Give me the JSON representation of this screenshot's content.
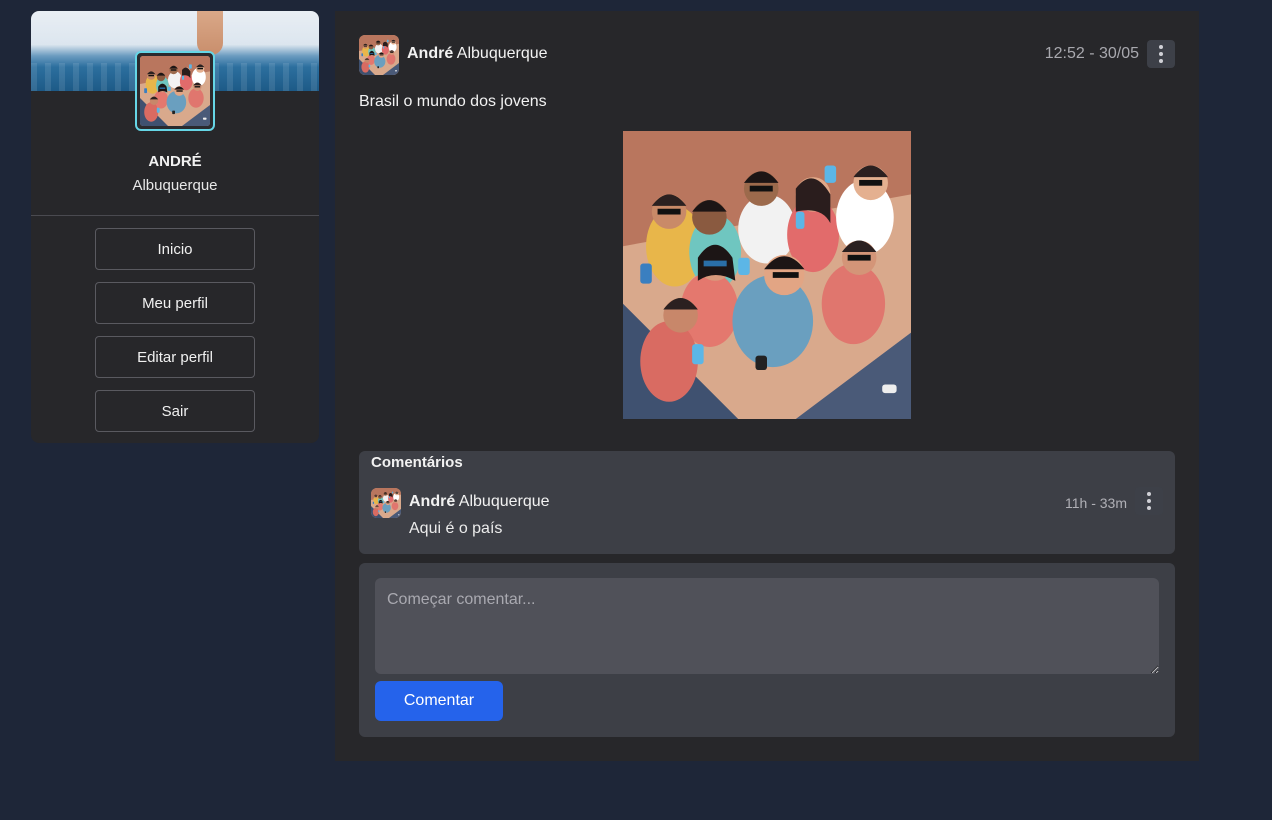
{
  "profile": {
    "first_name": "ANDRÉ",
    "last_name": "Albuquerque"
  },
  "sidebar": {
    "items": [
      {
        "label": "Inicio"
      },
      {
        "label": "Meu perfil"
      },
      {
        "label": "Editar perfil"
      },
      {
        "label": "Sair"
      }
    ]
  },
  "post": {
    "author_first": "André",
    "author_last": "Albuquerque",
    "timestamp": "12:52 - 30/05",
    "text": "Brasil o mundo dos jovens"
  },
  "comments": {
    "title": "Comentários",
    "items": [
      {
        "author_first": "André",
        "author_last": "Albuquerque",
        "time": "11h - 33m",
        "text": "Aqui é o país"
      }
    ]
  },
  "comment_form": {
    "placeholder": "Começar comentar...",
    "submit_label": "Comentar"
  },
  "colors": {
    "page_bg": "#1e2638",
    "card_bg": "#27272a",
    "panel_bg": "#3d3f46",
    "accent": "#2563eb",
    "avatar_border": "#66d6e6"
  },
  "icons": {
    "post_menu": "more-vertical-icon",
    "comment_menu": "more-vertical-icon"
  }
}
